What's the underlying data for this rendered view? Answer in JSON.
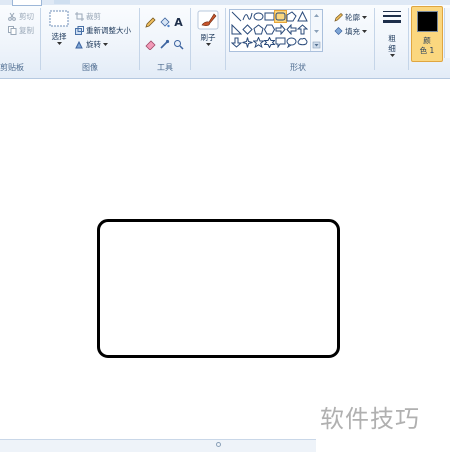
{
  "clipboard": {
    "cut_label": "剪切",
    "copy_label": "复制",
    "group_label": "剪贴板"
  },
  "image": {
    "select_label": "选择",
    "crop_label": "裁剪",
    "resize_label": "重新调整大小",
    "rotate_label": "旋转",
    "group_label": "图像"
  },
  "tools": {
    "group_label": "工具",
    "text_tool": "A"
  },
  "brushes": {
    "label": "刷子"
  },
  "shapes": {
    "group_label": "形状",
    "outline_label": "轮廓",
    "fill_label": "填充"
  },
  "size": {
    "label_line1": "粗",
    "label_line2": "细"
  },
  "colors": {
    "color1_label_line1": "颜",
    "color1_label_line2": "色 1",
    "color1_value": "#000000",
    "accent": "#fbd77f"
  },
  "watermark": {
    "text": "软件技巧"
  }
}
